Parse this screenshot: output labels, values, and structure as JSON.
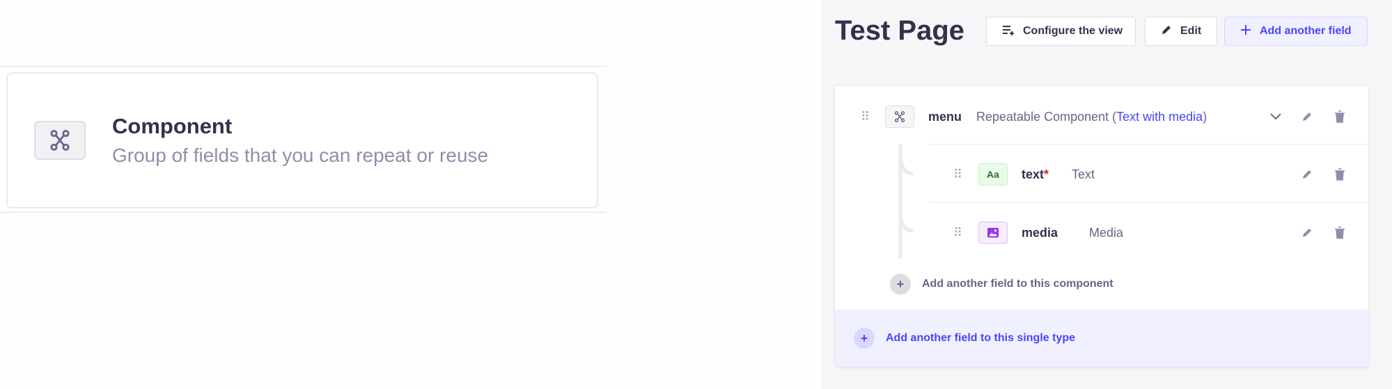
{
  "choice_card": {
    "title": "Component",
    "description": "Group of fields that you can repeat or reuse"
  },
  "header": {
    "title": "Test Page",
    "configure_label": "Configure the view",
    "edit_label": "Edit",
    "add_field_label": "Add another field"
  },
  "fields": {
    "menu": {
      "name": "menu",
      "type_prefix": "Repeatable Component (",
      "component_link": "Text with media",
      "type_suffix": ")"
    },
    "text": {
      "name": "text",
      "required_mark": "*",
      "type": "Text",
      "badge": "Aa"
    },
    "media": {
      "name": "media",
      "type": "Media"
    }
  },
  "add_component_field_label": "Add another field to this component",
  "add_single_type_field_label": "Add another field to this single type",
  "colors": {
    "accent": "#4945ff",
    "required": "#d02b20",
    "text_badge": "#eafbe7",
    "media_badge": "#f6ecfc"
  }
}
